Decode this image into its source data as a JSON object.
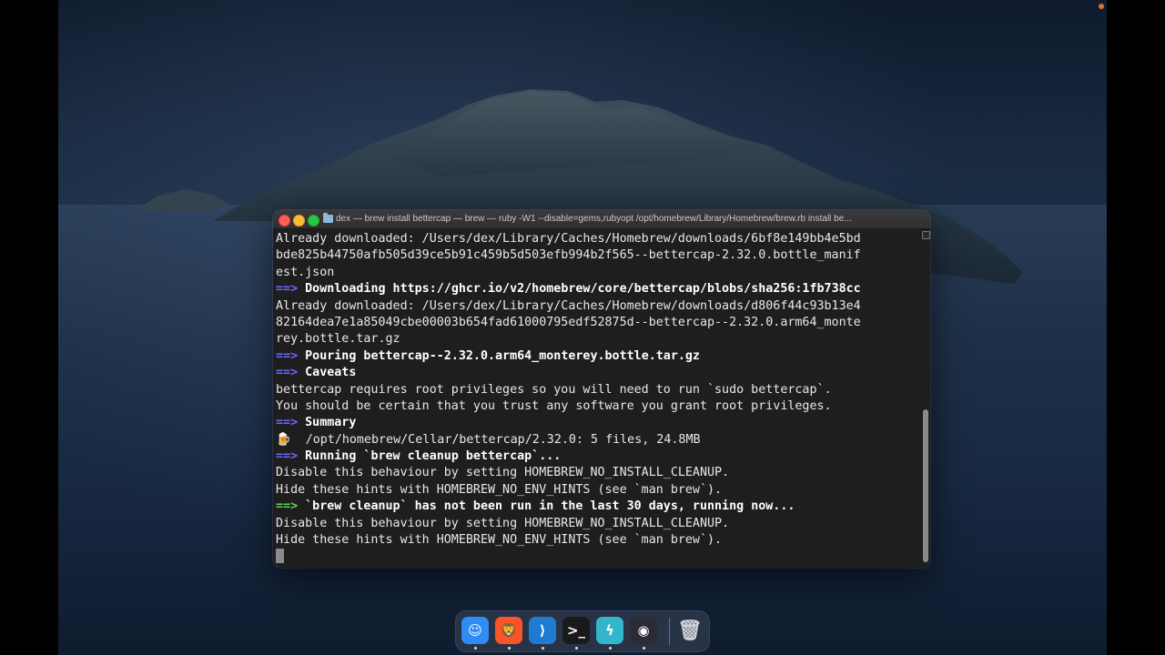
{
  "window": {
    "title": "dex — brew install bettercap — brew — ruby -W1 --disable=gems,rubyopt /opt/homebrew/Library/Homebrew/brew.rb install be..."
  },
  "terminal": {
    "lines": [
      {
        "text": "Already downloaded: /Users/dex/Library/Caches/Homebrew/downloads/6bf8e149bb4e5bd"
      },
      {
        "text": "bde825b44750afb505d39ce5b91c459b5d503efb994b2f565--bettercap-2.32.0.bottle_manif"
      },
      {
        "text": "est.json"
      },
      {
        "arrow": "==>",
        "text": " Downloading https://ghcr.io/v2/homebrew/core/bettercap/blobs/sha256:1fb738cc"
      },
      {
        "text": "Already downloaded: /Users/dex/Library/Caches/Homebrew/downloads/d806f44c93b13e4"
      },
      {
        "text": "82164dea7e1a85049cbe00003b654fad61000795edf52875d--bettercap--2.32.0.arm64_monte"
      },
      {
        "text": "rey.bottle.tar.gz"
      },
      {
        "arrow": "==>",
        "text": " Pouring bettercap--2.32.0.arm64_monterey.bottle.tar.gz"
      },
      {
        "arrow": "==>",
        "text": " Caveats"
      },
      {
        "text": "bettercap requires root privileges so you will need to run `sudo bettercap`."
      },
      {
        "text": "You should be certain that you trust any software you grant root privileges."
      },
      {
        "arrow": "==>",
        "text": " Summary"
      },
      {
        "emoji": "🍺",
        "text": "  /opt/homebrew/Cellar/bettercap/2.32.0: 5 files, 24.8MB"
      },
      {
        "arrow": "==>",
        "text": " Running `brew cleanup bettercap`..."
      },
      {
        "text": "Disable this behaviour by setting HOMEBREW_NO_INSTALL_CLEANUP."
      },
      {
        "text": "Hide these hints with HOMEBREW_NO_ENV_HINTS (see `man brew`)."
      },
      {
        "arrow": "==>",
        "arrow_color": "green",
        "text": " `brew cleanup` has not been run in the last 30 days, running now..."
      },
      {
        "text": "Disable this behaviour by setting HOMEBREW_NO_INSTALL_CLEANUP."
      },
      {
        "text": "Hide these hints with HOMEBREW_NO_ENV_HINTS (see `man brew`)."
      }
    ]
  },
  "dock": {
    "apps": [
      {
        "name": "finder-icon",
        "glyph": "☺",
        "bg": "#2f8cf5",
        "running": true
      },
      {
        "name": "brave-icon",
        "glyph": "🦁",
        "bg": "#fb542b",
        "running": true
      },
      {
        "name": "vscode-icon",
        "glyph": "⟩",
        "bg": "#1f7ad2",
        "running": true
      },
      {
        "name": "terminal-icon",
        "glyph": ">_",
        "bg": "#1a1a1a",
        "running": true
      },
      {
        "name": "bolt-app-icon",
        "glyph": "ϟ",
        "bg": "#33b6c9",
        "running": true
      },
      {
        "name": "obs-icon",
        "glyph": "◉",
        "bg": "#2b2b35",
        "running": true
      }
    ],
    "trash": {
      "name": "trash-icon",
      "glyph": "🗑"
    }
  },
  "colors": {
    "prompt_arrow": "#6b6bff",
    "prompt_arrow_green": "#5cd65c"
  }
}
